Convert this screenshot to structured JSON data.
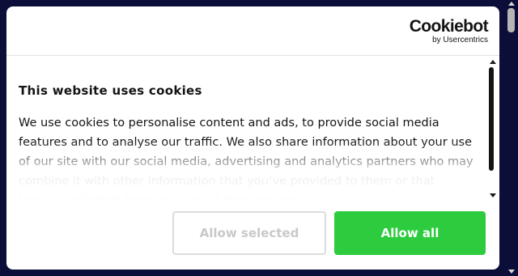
{
  "branding": {
    "logo_main": "Cookiebot",
    "logo_sub": "by Usercentrics"
  },
  "banner": {
    "title": "This website uses cookies",
    "body": "We use cookies to personalise content and ads, to provide social media features and to analyse our traffic. We also share information about your use of our site with our social media, advertising and analytics partners who may combine it with other information that you’ve provided to them or that they’ve collected from your use of their services."
  },
  "buttons": {
    "allow_selected": "Allow selected",
    "allow_all": "Allow all"
  },
  "colors": {
    "backdrop": "#0c0e3a",
    "accent_green": "#2dcc3e",
    "text": "#141414",
    "disabled_text": "#c9c9c9"
  },
  "icons": {
    "scroll_up": "arrow-up",
    "scroll_down": "arrow-down"
  }
}
